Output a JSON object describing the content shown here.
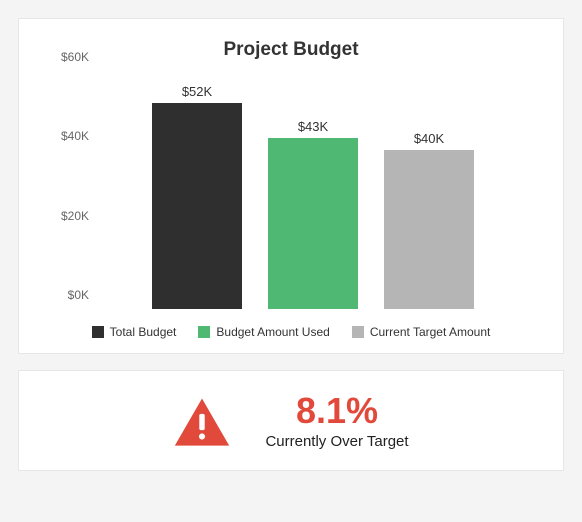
{
  "chart_data": {
    "type": "bar",
    "title": "Project Budget",
    "categories": [
      "Total Budget",
      "Budget Amount Used",
      "Current Target Amount"
    ],
    "values": [
      52,
      43,
      40
    ],
    "value_labels": [
      "$52K",
      "$43K",
      "$40K"
    ],
    "colors": [
      "#2f2f2f",
      "#4fb873",
      "#b5b5b5"
    ],
    "ylim": [
      0,
      60
    ],
    "y_ticks": [
      0,
      20,
      40,
      60
    ],
    "y_tick_labels": [
      "$0K",
      "$20K",
      "$40K",
      "$60K"
    ],
    "legend": [
      "Total Budget",
      "Budget Amount Used",
      "Current Target Amount"
    ]
  },
  "status": {
    "percent": "8.1%",
    "label": "Currently Over Target",
    "alert_color": "#e14a3b"
  }
}
